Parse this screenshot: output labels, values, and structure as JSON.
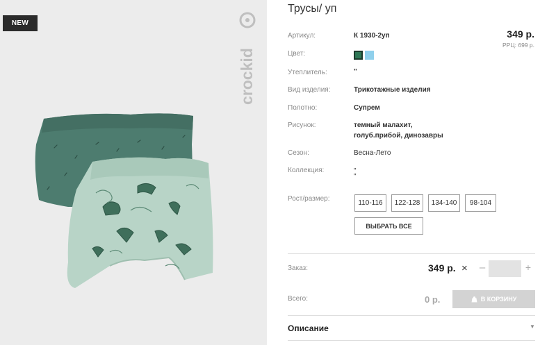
{
  "badge": {
    "new": "NEW"
  },
  "brand": {
    "logo": "crockid"
  },
  "product": {
    "title": "Трусы/ уп",
    "price": "349 р.",
    "rrp": "РРЦ: 699 р."
  },
  "specs": {
    "article": {
      "label": "Артикул:",
      "value": "К 1930-2уп"
    },
    "color": {
      "label": "Цвет:",
      "swatches": [
        "#2e7755",
        "#8fd0ec"
      ]
    },
    "insulation": {
      "label": "Утеплитель:",
      "value": "\""
    },
    "type": {
      "label": "Вид изделия:",
      "value": "Трикотажные изделия"
    },
    "fabric": {
      "label": "Полотно:",
      "value": "Супрем"
    },
    "pattern": {
      "label": "Рисунок:",
      "line1": "темный малахит,",
      "line2": "голуб.прибой, динозавры"
    },
    "season": {
      "label": "Сезон:",
      "value": "Весна-Лето"
    },
    "collection": {
      "label": "Коллекция:",
      "line1": "\"",
      "line2": "\""
    }
  },
  "sizes": {
    "label": "Рост/размер:",
    "options": [
      "110-116",
      "122-128",
      "134-140",
      "98-104"
    ],
    "select_all": "ВЫБРАТЬ ВСЕ"
  },
  "order": {
    "label": "Заказ:",
    "price": "349 р.",
    "times": "×",
    "minus": "–",
    "plus": "+",
    "quantity": ""
  },
  "total": {
    "label": "Всего:",
    "value": "0 р.",
    "cart_button": "В КОРЗИНУ"
  },
  "description": {
    "title": "Описание",
    "chevron": "▼"
  },
  "icons": {
    "cart": "shopping-bag-icon",
    "close": "times-icon",
    "chevron": "chevron-down-icon"
  }
}
